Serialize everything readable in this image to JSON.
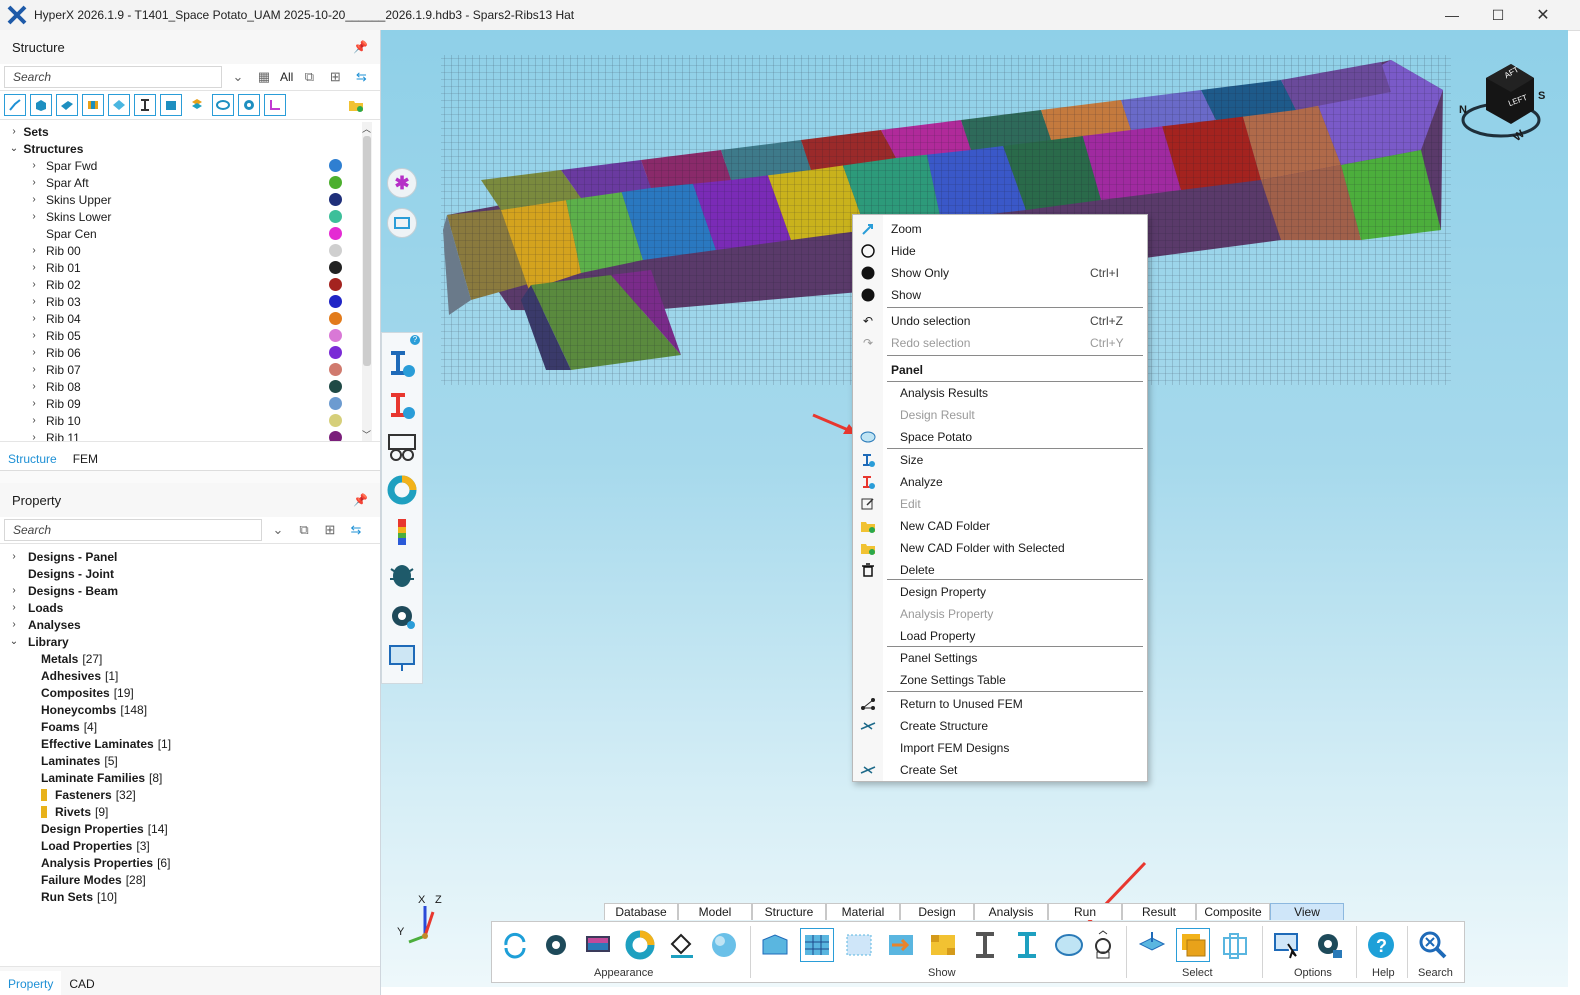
{
  "window": {
    "title": "HyperX 2026.1.9 - T1401_Space Potato_UAM 2025-10-20______2026.1.9.hdb3 - Spars2-Ribs13 Hat",
    "minimize": "—",
    "maximize": "☐",
    "close": "✕"
  },
  "structure_panel": {
    "title": "Structure",
    "search_placeholder": "Search",
    "all_label": "All",
    "sets_label": "Sets",
    "structures_label": "Structures",
    "items": [
      {
        "label": "Spar Fwd",
        "color": "#2f7fd1",
        "expandable": true
      },
      {
        "label": "Spar Aft",
        "color": "#4caf2e",
        "expandable": true
      },
      {
        "label": "Skins Upper",
        "color": "#1f2f7a",
        "expandable": true
      },
      {
        "label": "Skins Lower",
        "color": "#3dbf9a",
        "expandable": true
      },
      {
        "label": "Spar Cen",
        "color": "#e42bd3",
        "expandable": false
      },
      {
        "label": "Rib 00",
        "color": "#cfcfcf",
        "expandable": true
      },
      {
        "label": "Rib 01",
        "color": "#222222",
        "expandable": true
      },
      {
        "label": "Rib 02",
        "color": "#a4231f",
        "expandable": true
      },
      {
        "label": "Rib 03",
        "color": "#2025c6",
        "expandable": true
      },
      {
        "label": "Rib 04",
        "color": "#e27b1b",
        "expandable": true
      },
      {
        "label": "Rib 05",
        "color": "#d978d6",
        "expandable": true
      },
      {
        "label": "Rib 06",
        "color": "#7a2bd6",
        "expandable": true
      },
      {
        "label": "Rib 07",
        "color": "#d07a6e",
        "expandable": true
      },
      {
        "label": "Rib 08",
        "color": "#1f4a46",
        "expandable": true
      },
      {
        "label": "Rib 09",
        "color": "#6c9bd0",
        "expandable": true
      },
      {
        "label": "Rib 10",
        "color": "#d6cf7a",
        "expandable": true
      },
      {
        "label": "Rib 11",
        "color": "#7a1f7a",
        "expandable": true
      }
    ],
    "tabs": [
      "Structure",
      "FEM"
    ]
  },
  "property_panel": {
    "title": "Property",
    "search_placeholder": "Search",
    "top_items": [
      "Designs - Panel",
      "Designs - Joint",
      "Designs - Beam",
      "Loads",
      "Analyses",
      "Library"
    ],
    "library_items": [
      {
        "label": "Metals",
        "count": "[27]"
      },
      {
        "label": "Adhesives",
        "count": "[1]"
      },
      {
        "label": "Composites",
        "count": "[19]"
      },
      {
        "label": "Honeycombs",
        "count": "[148]"
      },
      {
        "label": "Foams",
        "count": "[4]"
      },
      {
        "label": "Effective Laminates",
        "count": "[1]"
      },
      {
        "label": "Laminates",
        "count": "[5]"
      },
      {
        "label": "Laminate Families",
        "count": "[8]"
      },
      {
        "label": "Fasteners",
        "count": "[32]"
      },
      {
        "label": "Rivets",
        "count": "[9]"
      },
      {
        "label": "Design Properties",
        "count": "[14]"
      },
      {
        "label": "Load Properties",
        "count": "[3]"
      },
      {
        "label": "Analysis Properties",
        "count": "[6]"
      },
      {
        "label": "Failure Modes",
        "count": "[28]"
      },
      {
        "label": "Run Sets",
        "count": "[10]"
      }
    ],
    "tabs": [
      "Property",
      "CAD"
    ]
  },
  "context_menu": {
    "zoom": "Zoom",
    "hide": "Hide",
    "show_only": "Show Only",
    "show_only_shortcut": "Ctrl+I",
    "show": "Show",
    "undo": "Undo selection",
    "undo_shortcut": "Ctrl+Z",
    "redo": "Redo selection",
    "redo_shortcut": "Ctrl+Y",
    "panel_header": "Panel",
    "analysis_results": "Analysis Results",
    "design_result": "Design Result",
    "space_potato": "Space Potato",
    "size": "Size",
    "analyze": "Analyze",
    "edit": "Edit",
    "new_cad_folder": "New CAD Folder",
    "new_cad_folder_selected": "New CAD Folder with Selected",
    "delete": "Delete",
    "design_property": "Design Property",
    "analysis_property": "Analysis Property",
    "load_property": "Load Property",
    "panel_settings": "Panel Settings",
    "zone_settings_table": "Zone Settings Table",
    "return_unused_fem": "Return to Unused FEM",
    "create_structure": "Create Structure",
    "import_fem_designs": "Import FEM Designs",
    "create_set": "Create Set"
  },
  "ribbon": {
    "tabs": [
      "Database",
      "Model",
      "Structure",
      "Material",
      "Design",
      "Analysis",
      "Run",
      "Result",
      "Composite",
      "View"
    ],
    "active_tab": "View",
    "groups": {
      "appearance": "Appearance",
      "show": "Show",
      "select": "Select",
      "options": "Options",
      "help": "Help",
      "search": "Search"
    }
  },
  "triad": {
    "x": "X",
    "y": "Y",
    "z": "Z"
  },
  "view_cube": {
    "face_top": "AFT",
    "face_side": "LEFT",
    "n": "N",
    "w": "W",
    "s": "S"
  },
  "colors": {
    "accent": "#1e90d5",
    "arrow": "#e8372f"
  }
}
